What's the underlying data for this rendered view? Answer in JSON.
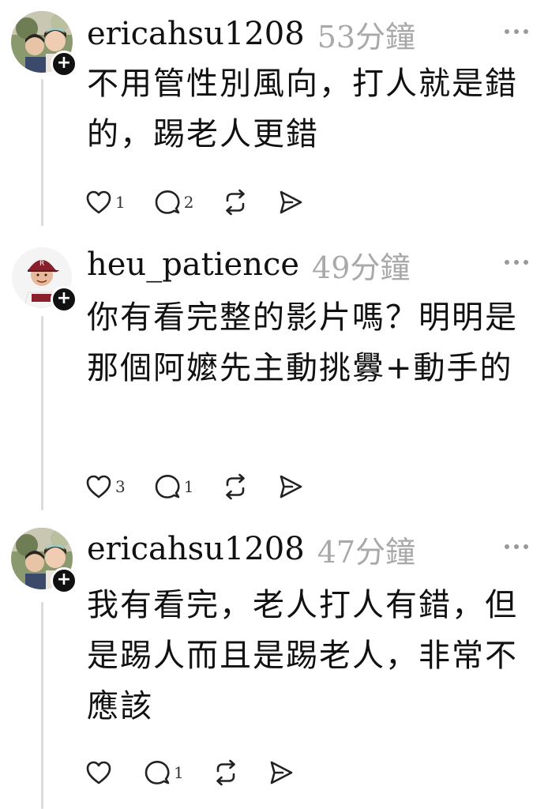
{
  "replies": [
    {
      "username": "ericahsu1208",
      "time": "53分鐘",
      "text": "不用管性別風向，打人就是錯的，踢老人更錯",
      "likes": "1",
      "comments": "2",
      "reposts": "",
      "avatar": "family-photo-avatar"
    },
    {
      "username": "heu_patience",
      "time": "49分鐘",
      "text": "你有看完整的影片嗎？明明是那個阿嬤先主動挑釁+動手的",
      "likes": "3",
      "comments": "1",
      "reposts": "",
      "avatar": "baseball-player-avatar"
    },
    {
      "username": "ericahsu1208",
      "time": "47分鐘",
      "text": "我有看完，老人打人有錯，但是踢人而且是踢老人，非常不應該",
      "likes": "",
      "comments": "1",
      "reposts": "",
      "avatar": "family-photo-avatar"
    }
  ],
  "icons": {
    "like": "heart-icon",
    "comment": "comment-bubble-icon",
    "repost": "repost-icon",
    "share": "send-icon",
    "more": "more-dots-icon",
    "follow": "plus-icon"
  },
  "colors": {
    "text": "#111111",
    "muted": "#a9a9a9",
    "line": "#dcdcdc"
  }
}
